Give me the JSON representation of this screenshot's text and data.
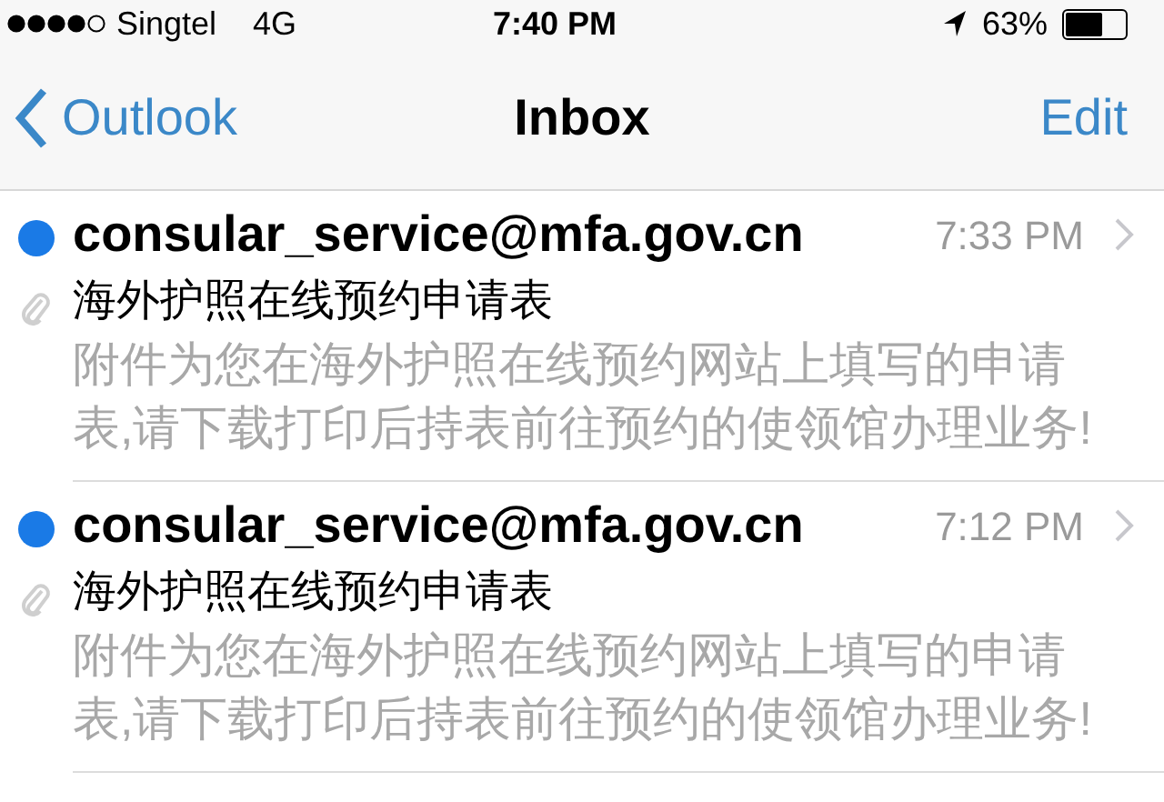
{
  "status_bar": {
    "carrier": "Singtel",
    "network": "4G",
    "time": "7:40 PM",
    "battery": "63%"
  },
  "nav_bar": {
    "back": "Outlook",
    "title": "Inbox",
    "action": "Edit"
  },
  "messages": [
    {
      "sender": "consular_service@mfa.gov.cn",
      "time": "7:33 PM",
      "subject": "海外护照在线预约申请表",
      "preview_lines": [
        "附件为您在海外护照在线预约网站上填写的申请",
        "表,请下载打印后持表前往预约的使领馆办理业务!"
      ],
      "unread": true,
      "attachment": true
    },
    {
      "sender": "consular_service@mfa.gov.cn",
      "time": "7:12 PM",
      "subject": "海外护照在线预约申请表",
      "preview_lines": [
        "附件为您在海外护照在线预约网站上填写的申请",
        "表,请下载打印后持表前往预约的使领馆办理业务!"
      ],
      "unread": true,
      "attachment": true
    }
  ]
}
